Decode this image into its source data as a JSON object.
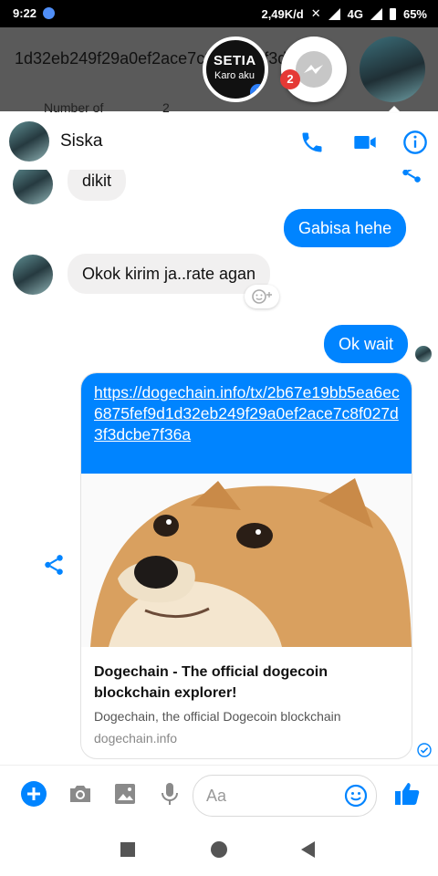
{
  "status_bar": {
    "time": "9:22",
    "speed": "2,49K/d",
    "network": "4G",
    "battery": "65%"
  },
  "background_app": {
    "hash_text": "1d32eb249f29a0ef2ace7c8f027d3f3dcbe7f3",
    "row_label": "Number of",
    "row_value": "2"
  },
  "chat_heads": {
    "setia_line1": "SETIA",
    "setia_line2": "Karo aku",
    "unread_badge": "2"
  },
  "header": {
    "contact_name": "Siska"
  },
  "messages": {
    "in_1": "dikit",
    "out_1": "Gabisa hehe",
    "in_2": "Okok kirim ja..rate agan",
    "out_2": "Ok wait"
  },
  "link_card": {
    "url": "https://dogechain.info/tx/2b67e19bb5ea6ec6875fef9d1d32eb249f29a0ef2ace7c8f027d3f3dcbe7f36a",
    "title": "Dogechain - The official dogecoin blockchain explorer!",
    "description": "Dogechain, the official Dogecoin blockchain",
    "domain": "dogechain.info"
  },
  "composer": {
    "placeholder": "Aa"
  },
  "colors": {
    "messenger_blue": "#0084ff",
    "incoming_bubble": "#f1f0f0",
    "badge_red": "#e53935"
  }
}
